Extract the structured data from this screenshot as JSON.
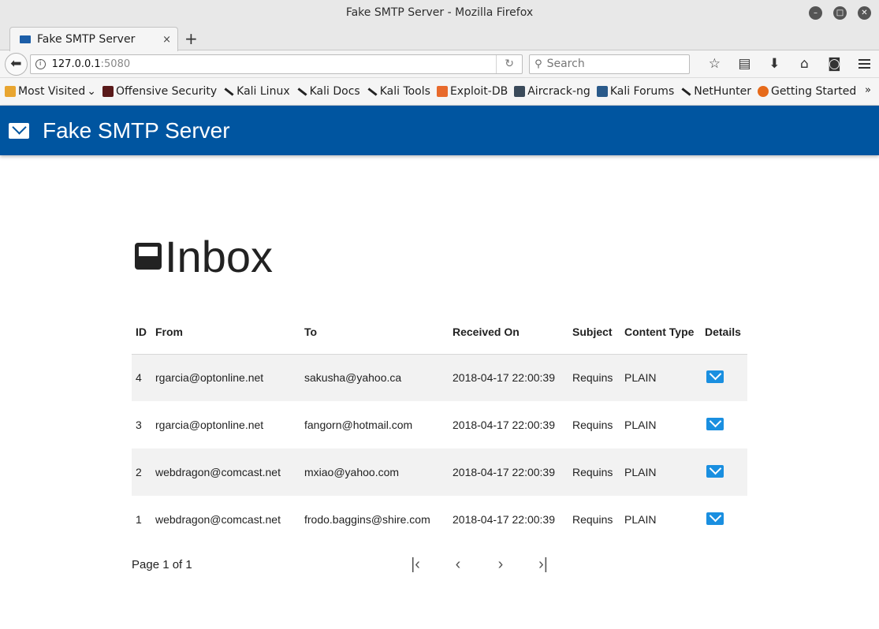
{
  "window": {
    "title": "Fake SMTP Server - Mozilla Firefox"
  },
  "tab": {
    "label": "Fake SMTP Server",
    "close": "×",
    "new_tab": "+"
  },
  "url": {
    "host": "127.0.0.1",
    "port": ":5080"
  },
  "search": {
    "placeholder": "Search"
  },
  "bookmarks": [
    {
      "label": "Most Visited",
      "icon": "folder-icon",
      "color": "#e8a530"
    },
    {
      "label": "Offensive Security",
      "icon": "offsec-icon",
      "color": "#5a1a1a"
    },
    {
      "label": "Kali Linux",
      "icon": "kali-dragon-icon"
    },
    {
      "label": "Kali Docs",
      "icon": "kali-dragon-icon"
    },
    {
      "label": "Kali Tools",
      "icon": "kali-dragon-icon"
    },
    {
      "label": "Exploit-DB",
      "icon": "exploitdb-icon",
      "color": "#e86a2c"
    },
    {
      "label": "Aircrack-ng",
      "icon": "aircrack-icon",
      "color": "#3a4a5a"
    },
    {
      "label": "Kali Forums",
      "icon": "kali-forums-icon",
      "color": "#2a5a8a"
    },
    {
      "label": "NetHunter",
      "icon": "kali-dragon-icon"
    },
    {
      "label": "Getting Started",
      "icon": "firefox-icon",
      "color": "#e66a1a"
    }
  ],
  "app": {
    "title": "Fake SMTP Server",
    "brand_color": "#0055a0"
  },
  "inbox": {
    "title": "Inbox"
  },
  "table": {
    "headers": [
      "ID",
      "From",
      "To",
      "Received On",
      "Subject",
      "Content Type",
      "Details"
    ],
    "rows": [
      [
        "4",
        "rgarcia@optonline.net",
        "sakusha@yahoo.ca",
        "2018-04-17 22:00:39",
        "Requins",
        "PLAIN"
      ],
      [
        "3",
        "rgarcia@optonline.net",
        "fangorn@hotmail.com",
        "2018-04-17 22:00:39",
        "Requins",
        "PLAIN"
      ],
      [
        "2",
        "webdragon@comcast.net",
        "mxiao@yahoo.com",
        "2018-04-17 22:00:39",
        "Requins",
        "PLAIN"
      ],
      [
        "1",
        "webdragon@comcast.net",
        "frodo.baggins@shire.com",
        "2018-04-17 22:00:39",
        "Requins",
        "PLAIN"
      ]
    ]
  },
  "pager": {
    "info": "Page 1 of 1"
  }
}
